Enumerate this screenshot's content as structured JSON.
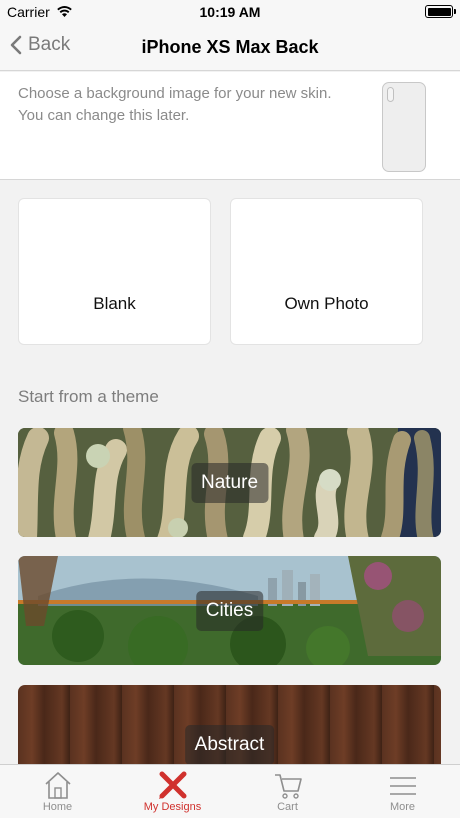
{
  "status_bar": {
    "carrier": "Carrier",
    "time": "10:19 AM"
  },
  "nav": {
    "back_label": "Back",
    "title": "iPhone XS Max Back"
  },
  "intro": {
    "text": "Choose a background image for your new skin. You can change this later."
  },
  "start_options": [
    {
      "label": "Blank"
    },
    {
      "label": "Own Photo"
    }
  ],
  "themes_heading": "Start from a theme",
  "themes": [
    {
      "label": "Nature"
    },
    {
      "label": "Cities"
    },
    {
      "label": "Abstract"
    }
  ],
  "tabs": [
    {
      "label": "Home",
      "icon": "house-icon",
      "active": false
    },
    {
      "label": "My Designs",
      "icon": "design-tools-icon",
      "active": true
    },
    {
      "label": "Cart",
      "icon": "cart-icon",
      "active": false
    },
    {
      "label": "More",
      "icon": "menu-lines-icon",
      "active": false
    }
  ],
  "colors": {
    "accent": "#d0312d",
    "inactive_tab": "#8e8e8e",
    "secondary_text": "#8a8a8a"
  }
}
